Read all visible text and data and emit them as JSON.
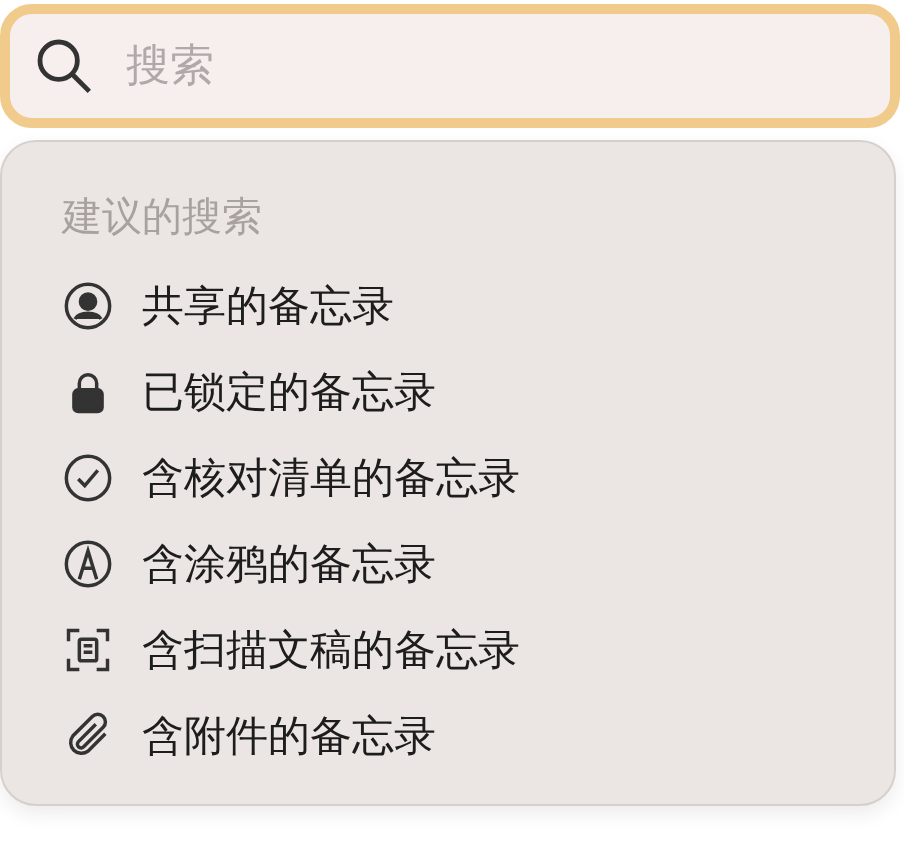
{
  "search": {
    "placeholder": "搜索",
    "focused": true
  },
  "suggestions": {
    "title": "建议的搜索",
    "items": [
      {
        "kind": "shared",
        "label": "共享的备忘录"
      },
      {
        "kind": "locked",
        "label": "已锁定的备忘录"
      },
      {
        "kind": "checklist",
        "label": "含核对清单的备忘录"
      },
      {
        "kind": "drawing",
        "label": "含涂鸦的备忘录"
      },
      {
        "kind": "scan",
        "label": "含扫描文稿的备忘录"
      },
      {
        "kind": "attachment",
        "label": "含附件的备忘录"
      }
    ]
  }
}
